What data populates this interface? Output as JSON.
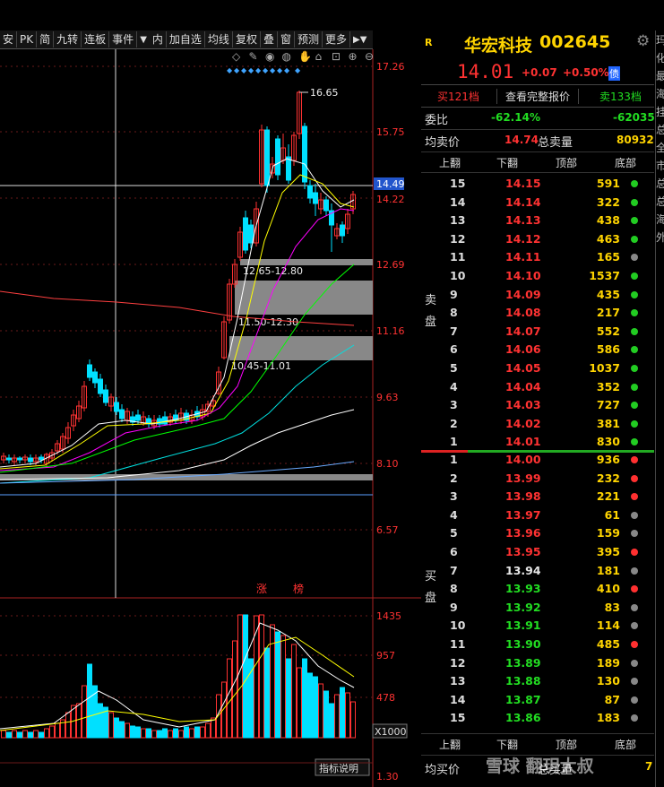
{
  "toolbar": {
    "items": [
      "安",
      "PK",
      "简",
      "九转",
      "连板",
      "事件",
      "内",
      "加自选",
      "均线",
      "复权",
      "叠",
      "窗",
      "预测",
      "更多"
    ],
    "arrow_icon": "dropdown-arrow-icon"
  },
  "chart": {
    "price_ticks": [
      "17.26",
      "15.75",
      "14.49",
      "14.22",
      "12.69",
      "11.16",
      "9.63",
      "8.10",
      "6.57"
    ],
    "current_price_marker": "14.49",
    "high_label": "16.65",
    "zone_labels": [
      "12.65-12.80",
      "11.50-12.30",
      "10.45-11.01"
    ],
    "board_labels": [
      "涨",
      "榜"
    ],
    "volume_ticks": [
      "1435",
      "957",
      "478"
    ],
    "volume_unit": "X1000",
    "indicator_button": "指标说明",
    "bottom_value": "1.30",
    "colors": {
      "up": "#ff3232",
      "down": "#00e0ff",
      "ma5": "#ffffff",
      "ma10": "#ffff00",
      "ma20": "#ff00ff",
      "ma30": "#00ff00",
      "ma60": "#00e0e0",
      "ma120": "#ffffff",
      "ma250": "#5aa0ff"
    }
  },
  "quote": {
    "corner": "R",
    "name": "华宏科技",
    "code": "002645",
    "price": "14.01",
    "change": "+0.07",
    "change_pct": "+0.50%",
    "badge": "债",
    "buy_count_button": "买121档",
    "full_quote_button": "查看完整报价",
    "sell_count_button": "卖133档",
    "ratio_label": "委比",
    "ratio_pct": "-62.14%",
    "ratio_diff": "-62035",
    "avg_label": "均卖价",
    "avg_value": "14.74",
    "total_label": "总卖量",
    "total_value": "80932",
    "nav": [
      "上翻",
      "下翻",
      "顶部",
      "底部"
    ],
    "sell_side_label": [
      "卖",
      "盘"
    ],
    "buy_side_label": [
      "买",
      "盘"
    ],
    "bottom_avg_label": "均买价",
    "bottom_total_label": "总买量",
    "bottom_avg_value": "",
    "bottom_total_value": "7"
  },
  "asks": [
    {
      "level": "15",
      "price": "14.15",
      "vol": "591",
      "dot": "#22cc22"
    },
    {
      "level": "14",
      "price": "14.14",
      "vol": "322",
      "dot": "#22cc22"
    },
    {
      "level": "13",
      "price": "14.13",
      "vol": "438",
      "dot": "#22cc22"
    },
    {
      "level": "12",
      "price": "14.12",
      "vol": "463",
      "dot": "#22cc22"
    },
    {
      "level": "11",
      "price": "14.11",
      "vol": "165",
      "dot": "#888888"
    },
    {
      "level": "10",
      "price": "14.10",
      "vol": "1537",
      "dot": "#22cc22"
    },
    {
      "level": "9",
      "price": "14.09",
      "vol": "435",
      "dot": "#22cc22"
    },
    {
      "level": "8",
      "price": "14.08",
      "vol": "217",
      "dot": "#22cc22"
    },
    {
      "level": "7",
      "price": "14.07",
      "vol": "552",
      "dot": "#22cc22"
    },
    {
      "level": "6",
      "price": "14.06",
      "vol": "586",
      "dot": "#22cc22"
    },
    {
      "level": "5",
      "price": "14.05",
      "vol": "1037",
      "dot": "#22cc22"
    },
    {
      "level": "4",
      "price": "14.04",
      "vol": "352",
      "dot": "#22cc22"
    },
    {
      "level": "3",
      "price": "14.03",
      "vol": "727",
      "dot": "#22cc22"
    },
    {
      "level": "2",
      "price": "14.02",
      "vol": "381",
      "dot": "#22cc22"
    },
    {
      "level": "1",
      "price": "14.01",
      "vol": "830",
      "dot": "#22cc22"
    }
  ],
  "bids": [
    {
      "level": "1",
      "price": "14.00",
      "vol": "936",
      "dot": "#ff3030",
      "pc": "#ff3232"
    },
    {
      "level": "2",
      "price": "13.99",
      "vol": "232",
      "dot": "#ff3030",
      "pc": "#ff3232"
    },
    {
      "level": "3",
      "price": "13.98",
      "vol": "221",
      "dot": "#ff3030",
      "pc": "#ff3232"
    },
    {
      "level": "4",
      "price": "13.97",
      "vol": "61",
      "dot": "#888888",
      "pc": "#ff3232"
    },
    {
      "level": "5",
      "price": "13.96",
      "vol": "159",
      "dot": "#888888",
      "pc": "#ff3232"
    },
    {
      "level": "6",
      "price": "13.95",
      "vol": "395",
      "dot": "#ff3030",
      "pc": "#ff3232"
    },
    {
      "level": "7",
      "price": "13.94",
      "vol": "181",
      "dot": "#888888",
      "pc": "#e6e6e6"
    },
    {
      "level": "8",
      "price": "13.93",
      "vol": "410",
      "dot": "#ff3030",
      "pc": "#22dd22"
    },
    {
      "level": "9",
      "price": "13.92",
      "vol": "83",
      "dot": "#888888",
      "pc": "#22dd22"
    },
    {
      "level": "10",
      "price": "13.91",
      "vol": "114",
      "dot": "#888888",
      "pc": "#22dd22"
    },
    {
      "level": "11",
      "price": "13.90",
      "vol": "485",
      "dot": "#ff3030",
      "pc": "#22dd22"
    },
    {
      "level": "12",
      "price": "13.89",
      "vol": "189",
      "dot": "#888888",
      "pc": "#22dd22"
    },
    {
      "level": "13",
      "price": "13.88",
      "vol": "130",
      "dot": "#888888",
      "pc": "#22dd22"
    },
    {
      "level": "14",
      "price": "13.87",
      "vol": "87",
      "dot": "#888888",
      "pc": "#22dd22"
    },
    {
      "level": "15",
      "price": "13.86",
      "vol": "183",
      "dot": "#888888",
      "pc": "#22dd22"
    }
  ],
  "watermark": "雪球 翻玥大叔",
  "edge_text": [
    "玛",
    "化",
    "最",
    "海",
    "挂",
    "总",
    "全",
    "市",
    "总",
    "总",
    "海",
    "外"
  ]
}
